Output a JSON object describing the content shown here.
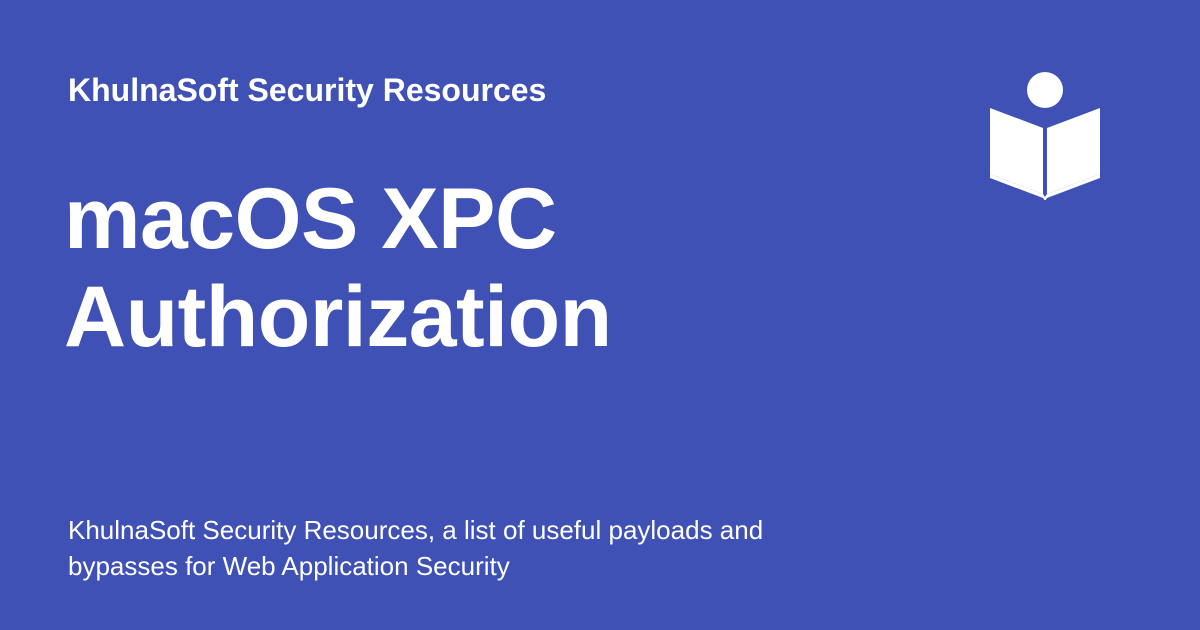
{
  "header": {
    "site_name": "KhulnaSoft Security Resources"
  },
  "page": {
    "title_lines": [
      "macOS XPC",
      "Authorization"
    ]
  },
  "footer": {
    "description_lines": [
      "KhulnaSoft Security Resources, a list of useful payloads and",
      "bypasses for Web Application Security"
    ]
  },
  "logo": {
    "icon": "book-reader-icon"
  },
  "colors": {
    "background": "#3f51b5",
    "text": "#ffffff"
  }
}
